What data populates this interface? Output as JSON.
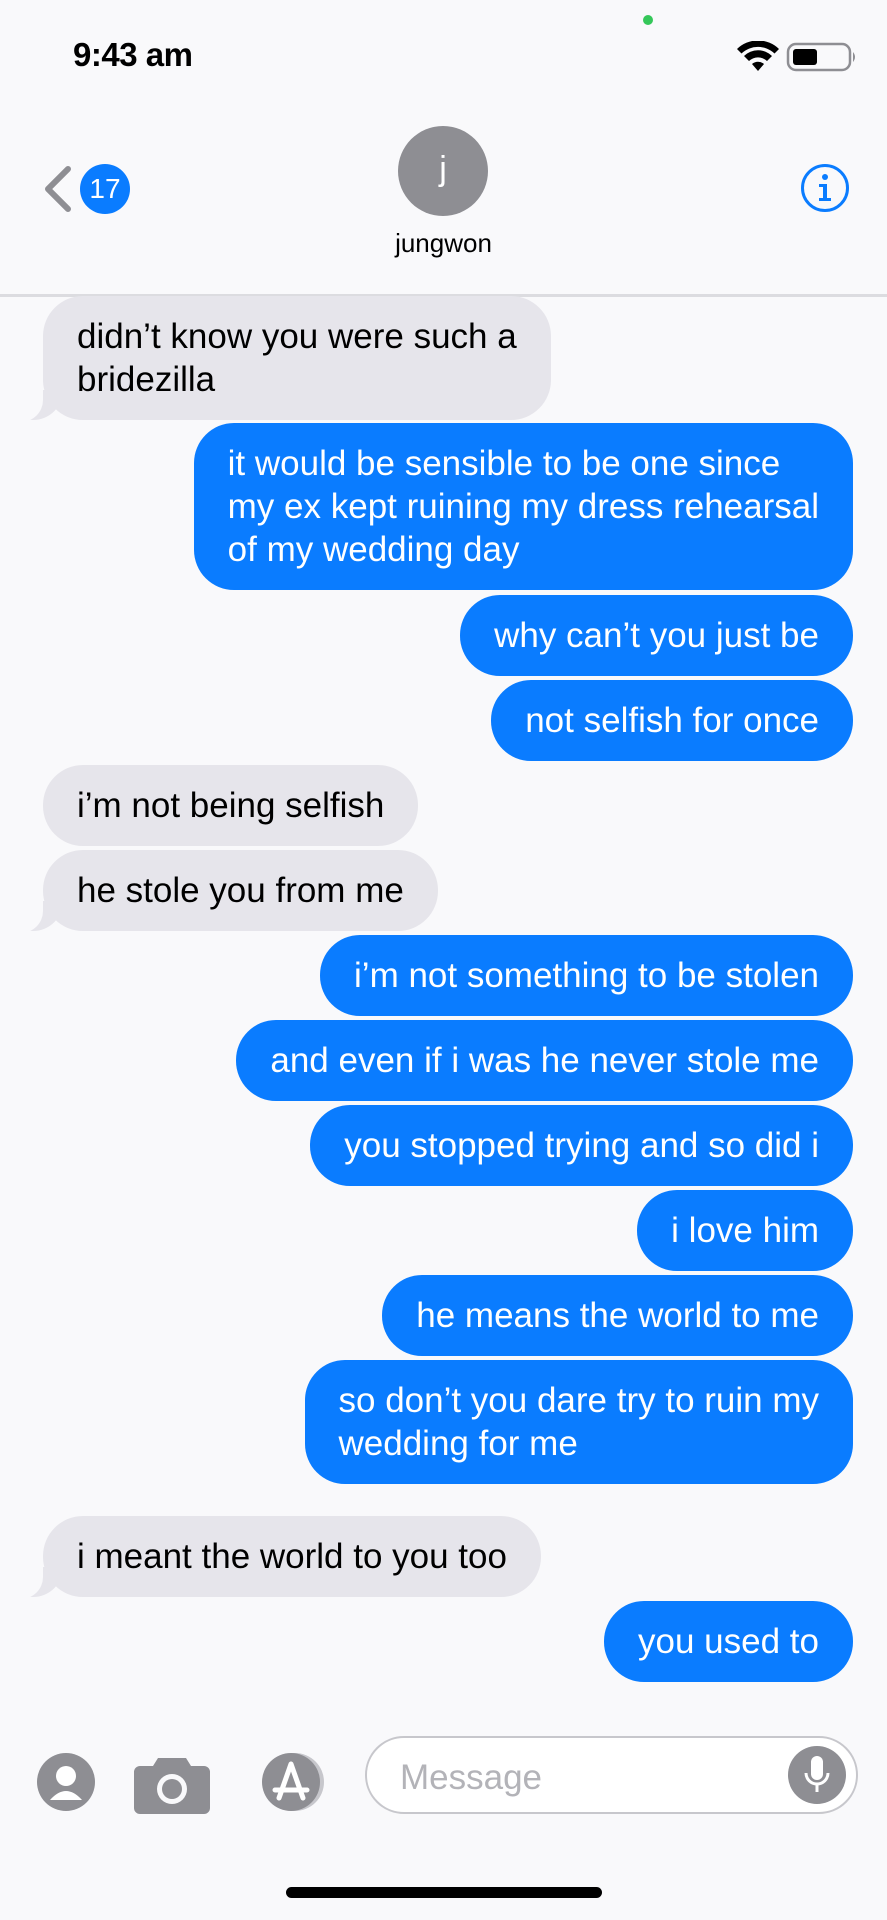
{
  "status_bar": {
    "time": "9:43 am"
  },
  "header": {
    "back_badge": "17",
    "avatar_initial": "j",
    "contact_name": "jungwon"
  },
  "messages": [
    {
      "direction": "incoming",
      "text": "didn’t know you were such a\nbridezilla"
    },
    {
      "direction": "outgoing",
      "text": "it would be sensible to be one since\nmy ex kept ruining my dress rehearsal\nof my wedding day"
    },
    {
      "direction": "outgoing",
      "text": "why can’t you just be"
    },
    {
      "direction": "outgoing",
      "text": "not selfish for once"
    },
    {
      "direction": "incoming",
      "text": "i’m not being selfish"
    },
    {
      "direction": "incoming",
      "text": "he stole you from me"
    },
    {
      "direction": "outgoing",
      "text": "i’m not something to be stolen"
    },
    {
      "direction": "outgoing",
      "text": "and even if i was he never stole me"
    },
    {
      "direction": "outgoing",
      "text": "you stopped trying and so did i"
    },
    {
      "direction": "outgoing",
      "text": "i love him"
    },
    {
      "direction": "outgoing",
      "text": "he means the world to me"
    },
    {
      "direction": "outgoing",
      "text": "so don’t you dare try to ruin my\nwedding for me"
    },
    {
      "direction": "incoming",
      "text": "i meant the world to you too"
    },
    {
      "direction": "outgoing",
      "text": "you used to"
    }
  ],
  "input_bar": {
    "placeholder": "Message"
  },
  "colors": {
    "outgoing": "#0a7cff",
    "incoming": "#e6e5eb",
    "accent": "#0a7cff"
  }
}
